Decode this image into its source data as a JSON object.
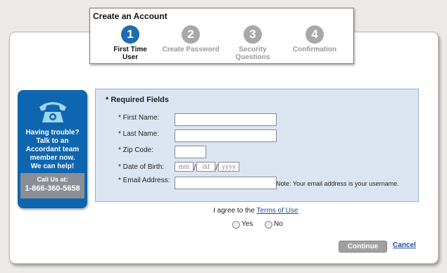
{
  "header": {
    "title": "Create an Account",
    "steps": [
      {
        "number": "1",
        "label": "First Time\nUser",
        "state": "active"
      },
      {
        "number": "2",
        "label": "Create Password",
        "state": "inactive"
      },
      {
        "number": "3",
        "label": "Security\nQuestions",
        "state": "inactive"
      },
      {
        "number": "4",
        "label": "Confirmation",
        "state": "inactive"
      }
    ]
  },
  "help": {
    "icon": "phone-icon",
    "text": "Having trouble?\nTalk to an\nAccordant team\nmember now.\nWe can help!",
    "call_label": "Call Us at:",
    "phone_number": "1-866-360-5658"
  },
  "form": {
    "required_note": "* Required Fields",
    "first_name_label": "* First Name:",
    "last_name_label": "* Last Name:",
    "zip_label": "* Zip Code:",
    "dob_label": "* Date of Birth:",
    "dob_mm_placeholder": "mm",
    "dob_dd_placeholder": "dd",
    "dob_yyyy_placeholder": "yyyy",
    "email_label": "* Email Address:",
    "email_note": "Note: Your email address is your username.",
    "first_name_value": "",
    "last_name_value": "",
    "zip_value": "",
    "email_value": ""
  },
  "agreement": {
    "text": "I agree to the",
    "terms_link": "Terms of Use",
    "yes_label": "Yes",
    "no_label": "No"
  },
  "actions": {
    "continue_label": "Continue",
    "cancel_label": "Cancel"
  },
  "colors": {
    "accent": "#1d6bb3",
    "help_bg": "#0f66b0",
    "form_bg": "#dbe5f1",
    "inactive_step": "#a8a8a8"
  }
}
